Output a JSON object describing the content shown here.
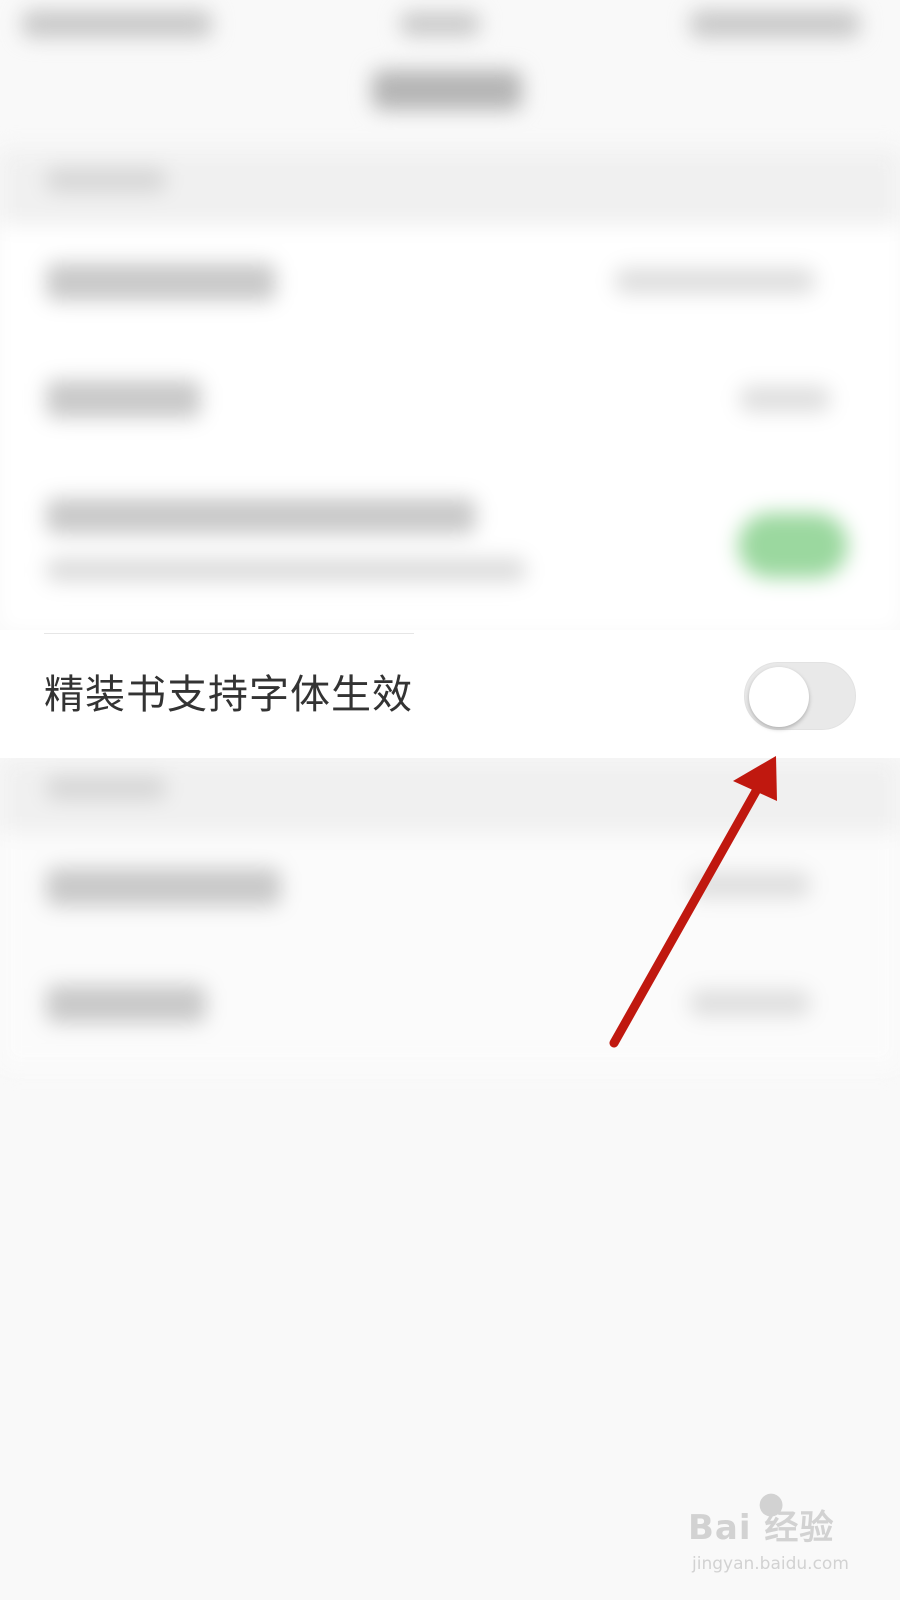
{
  "setting_row": {
    "label": "精装书支持字体生效",
    "toggle_state": "off"
  },
  "watermark": {
    "logo_text": "Bai  经验",
    "url": "jingyan.baidu.com"
  },
  "colors": {
    "background": "#f9f9f9",
    "label_text": "#333333",
    "toggle_track": "#e9e9e9",
    "toggle_knob": "#ffffff",
    "blurred_green_toggle": "#9bd89f",
    "annotation_arrow": "#c0180f"
  }
}
